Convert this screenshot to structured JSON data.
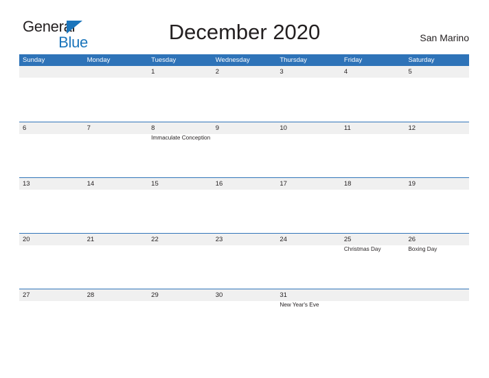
{
  "brand": {
    "name_part1": "General",
    "name_part2": "Blue",
    "accent_color": "#1b75bb"
  },
  "header": {
    "title": "December 2020",
    "location": "San Marino"
  },
  "theme": {
    "header_bar_color": "#2e73b8",
    "date_band_color": "#f0f0f0",
    "row_divider_color": "#2e73b8",
    "text_color": "#231f20",
    "background": "#ffffff"
  },
  "calendar": {
    "weekday_headers": [
      "Sunday",
      "Monday",
      "Tuesday",
      "Wednesday",
      "Thursday",
      "Friday",
      "Saturday"
    ],
    "weeks": [
      [
        {
          "date": "",
          "events": []
        },
        {
          "date": "",
          "events": []
        },
        {
          "date": "1",
          "events": []
        },
        {
          "date": "2",
          "events": []
        },
        {
          "date": "3",
          "events": []
        },
        {
          "date": "4",
          "events": []
        },
        {
          "date": "5",
          "events": []
        }
      ],
      [
        {
          "date": "6",
          "events": []
        },
        {
          "date": "7",
          "events": []
        },
        {
          "date": "8",
          "events": [
            "Immaculate Conception"
          ]
        },
        {
          "date": "9",
          "events": []
        },
        {
          "date": "10",
          "events": []
        },
        {
          "date": "11",
          "events": []
        },
        {
          "date": "12",
          "events": []
        }
      ],
      [
        {
          "date": "13",
          "events": []
        },
        {
          "date": "14",
          "events": []
        },
        {
          "date": "15",
          "events": []
        },
        {
          "date": "16",
          "events": []
        },
        {
          "date": "17",
          "events": []
        },
        {
          "date": "18",
          "events": []
        },
        {
          "date": "19",
          "events": []
        }
      ],
      [
        {
          "date": "20",
          "events": []
        },
        {
          "date": "21",
          "events": []
        },
        {
          "date": "22",
          "events": []
        },
        {
          "date": "23",
          "events": []
        },
        {
          "date": "24",
          "events": []
        },
        {
          "date": "25",
          "events": [
            "Christmas Day"
          ]
        },
        {
          "date": "26",
          "events": [
            "Boxing Day"
          ]
        }
      ],
      [
        {
          "date": "27",
          "events": []
        },
        {
          "date": "28",
          "events": []
        },
        {
          "date": "29",
          "events": []
        },
        {
          "date": "30",
          "events": []
        },
        {
          "date": "31",
          "events": [
            "New Year's Eve"
          ]
        },
        {
          "date": "",
          "events": []
        },
        {
          "date": "",
          "events": []
        }
      ]
    ]
  }
}
